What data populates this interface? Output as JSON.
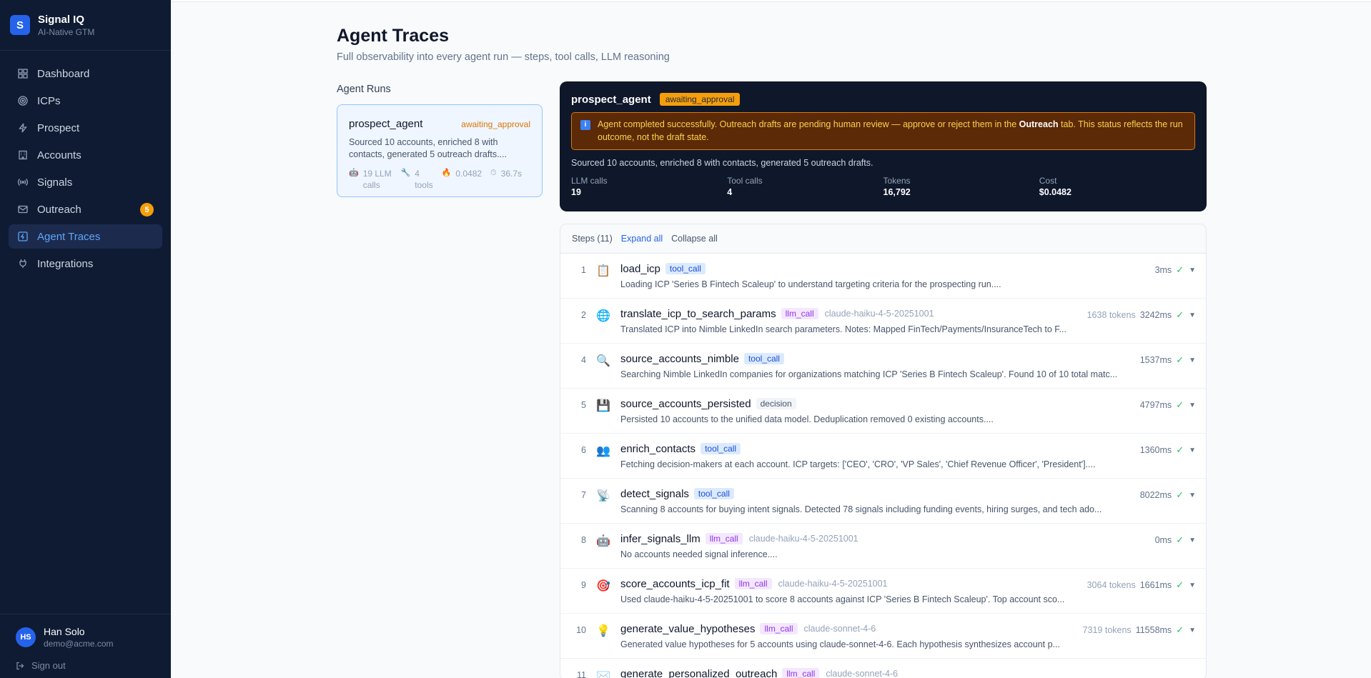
{
  "brand": {
    "logo": "S",
    "name": "Signal IQ",
    "tagline": "AI-Native GTM"
  },
  "nav": [
    {
      "label": "Dashboard",
      "icon": "grid-icon"
    },
    {
      "label": "ICPs",
      "icon": "target-icon"
    },
    {
      "label": "Prospect",
      "icon": "lightning-icon"
    },
    {
      "label": "Accounts",
      "icon": "building-icon"
    },
    {
      "label": "Signals",
      "icon": "broadcast-icon"
    },
    {
      "label": "Outreach",
      "icon": "mail-icon",
      "badge": "5"
    },
    {
      "label": "Agent Traces",
      "icon": "trace-icon",
      "active": true
    },
    {
      "label": "Integrations",
      "icon": "plug-icon"
    }
  ],
  "user": {
    "initials": "HS",
    "name": "Han Solo",
    "email": "demo@acme.com",
    "signout": "Sign out"
  },
  "page": {
    "title": "Agent Traces",
    "subtitle": "Full observability into every agent run — steps, tool calls, LLM reasoning",
    "runs_label": "Agent Runs"
  },
  "run": {
    "name": "prospect_agent",
    "status": "awaiting_approval",
    "desc": "Sourced 10 accounts, enriched 8 with contacts, generated 5 outreach drafts....",
    "llm_calls": "19 LLM calls",
    "tools": "4 tools",
    "cost": "0.0482",
    "duration": "36.7s"
  },
  "summary": {
    "name": "prospect_agent",
    "status": "awaiting_approval",
    "notice_icon": "i",
    "notice_pre": "Agent completed successfully. Outreach drafts are pending human review — approve or reject them in the ",
    "notice_bold": "Outreach",
    "notice_post": " tab. This status reflects the run outcome, not the draft state.",
    "desc": "Sourced 10 accounts, enriched 8 with contacts, generated 5 outreach drafts.",
    "metrics": [
      {
        "label": "LLM calls",
        "value": "19"
      },
      {
        "label": "Tool calls",
        "value": "4"
      },
      {
        "label": "Tokens",
        "value": "16,792"
      },
      {
        "label": "Cost",
        "value": "$0.0482"
      }
    ]
  },
  "steps_header": {
    "count": "Steps (11)",
    "expand": "Expand all",
    "collapse": "Collapse all"
  },
  "steps": [
    {
      "num": "1",
      "icon": "📋",
      "title": "load_icp",
      "tag": "tool_call",
      "tag_type": "tool",
      "model": "",
      "desc": "Loading ICP 'Series B Fintech Scaleup' to understand targeting criteria for the prospecting run....",
      "tokens": "",
      "duration": "3ms"
    },
    {
      "num": "2",
      "icon": "🌐",
      "title": "translate_icp_to_search_params",
      "tag": "llm_call",
      "tag_type": "llm",
      "model": "claude-haiku-4-5-20251001",
      "desc": "Translated ICP into Nimble LinkedIn search parameters. Notes: Mapped FinTech/Payments/InsuranceTech to F...",
      "tokens": "1638 tokens",
      "duration": "3242ms"
    },
    {
      "num": "4",
      "icon": "🔍",
      "title": "source_accounts_nimble",
      "tag": "tool_call",
      "tag_type": "tool",
      "model": "",
      "desc": "Searching Nimble LinkedIn companies for organizations matching ICP 'Series B Fintech Scaleup'. Found 10 of 10 total matc...",
      "tokens": "",
      "duration": "1537ms"
    },
    {
      "num": "5",
      "icon": "💾",
      "title": "source_accounts_persisted",
      "tag": "decision",
      "tag_type": "decision",
      "model": "",
      "desc": "Persisted 10 accounts to the unified data model. Deduplication removed 0 existing accounts....",
      "tokens": "",
      "duration": "4797ms"
    },
    {
      "num": "6",
      "icon": "👥",
      "title": "enrich_contacts",
      "tag": "tool_call",
      "tag_type": "tool",
      "model": "",
      "desc": "Fetching decision-makers at each account. ICP targets: ['CEO', 'CRO', 'VP Sales', 'Chief Revenue Officer', 'President']....",
      "tokens": "",
      "duration": "1360ms"
    },
    {
      "num": "7",
      "icon": "📡",
      "title": "detect_signals",
      "tag": "tool_call",
      "tag_type": "tool",
      "model": "",
      "desc": "Scanning 8 accounts for buying intent signals. Detected 78 signals including funding events, hiring surges, and tech ado...",
      "tokens": "",
      "duration": "8022ms"
    },
    {
      "num": "8",
      "icon": "🤖",
      "title": "infer_signals_llm",
      "tag": "llm_call",
      "tag_type": "llm",
      "model": "claude-haiku-4-5-20251001",
      "desc": "No accounts needed signal inference....",
      "tokens": "",
      "duration": "0ms"
    },
    {
      "num": "9",
      "icon": "🎯",
      "title": "score_accounts_icp_fit",
      "tag": "llm_call",
      "tag_type": "llm",
      "model": "claude-haiku-4-5-20251001",
      "desc": "Used claude-haiku-4-5-20251001 to score 8 accounts against ICP 'Series B Fintech Scaleup'. Top account sco...",
      "tokens": "3064 tokens",
      "duration": "1661ms"
    },
    {
      "num": "10",
      "icon": "💡",
      "title": "generate_value_hypotheses",
      "tag": "llm_call",
      "tag_type": "llm",
      "model": "claude-sonnet-4-6",
      "desc": "Generated value hypotheses for 5 accounts using claude-sonnet-4-6. Each hypothesis synthesizes account p...",
      "tokens": "7319 tokens",
      "duration": "11558ms"
    },
    {
      "num": "11",
      "icon": "✉️",
      "title": "generate_personalized_outreach",
      "tag": "llm_call",
      "tag_type": "llm",
      "model": "claude-sonnet-4-6",
      "desc": "",
      "tokens": "",
      "duration": ""
    }
  ],
  "colors": {
    "sidebar_bg": "#0f1b33",
    "accent": "#2563eb",
    "warning": "#f59e0b",
    "success": "#22c55e"
  }
}
